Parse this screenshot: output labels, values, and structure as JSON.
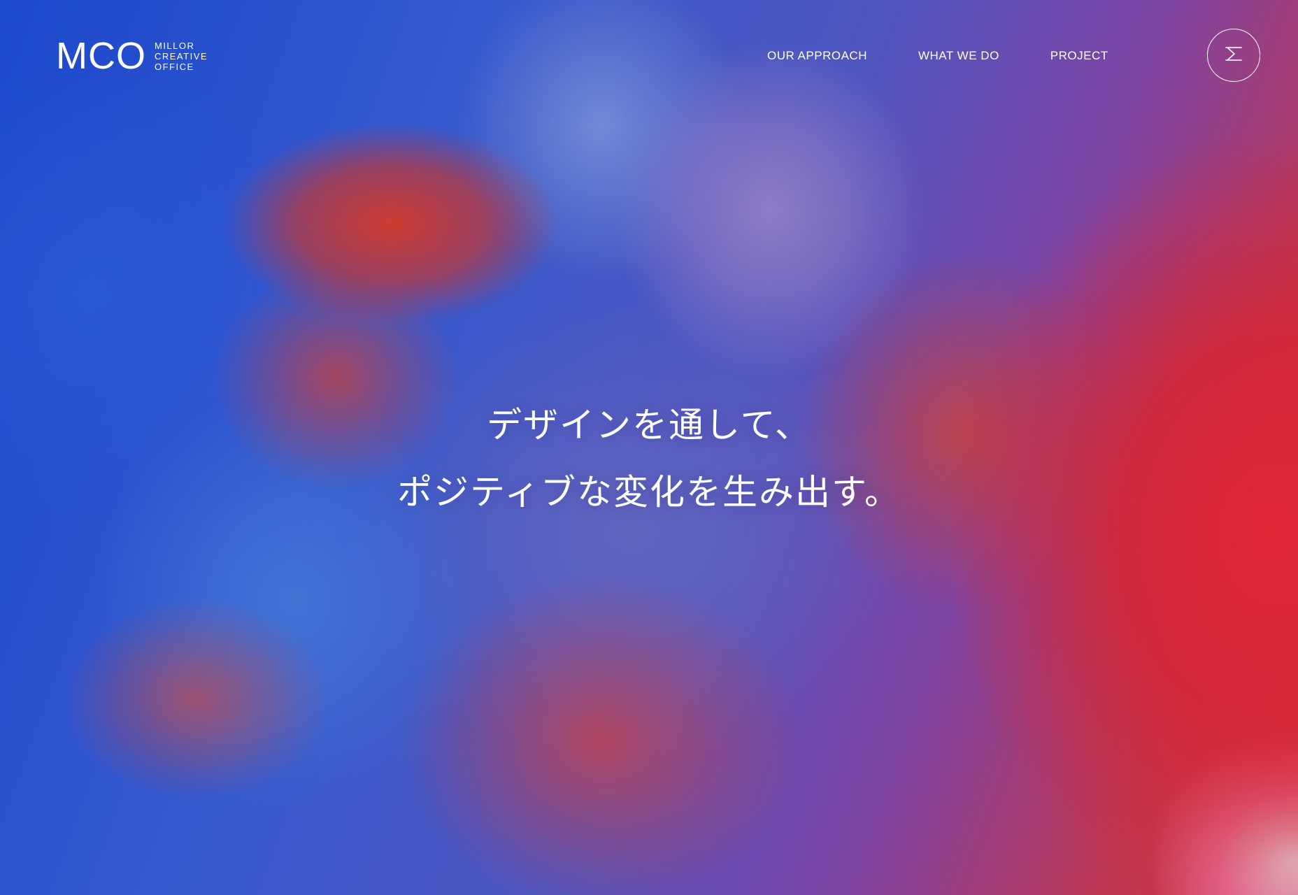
{
  "header": {
    "logo": {
      "mark": "MCO",
      "sub_lines": [
        "MILLOR",
        "CREATIVE",
        "OFFICE"
      ]
    },
    "nav": [
      {
        "label": "OUR APPROACH"
      },
      {
        "label": "WHAT WE DO"
      },
      {
        "label": "PROJECT"
      }
    ],
    "menu_button": {
      "icon": "menu-m-icon"
    }
  },
  "hero": {
    "tagline": [
      "デザインを通して、",
      "ポジティブな変化を生み出す。"
    ],
    "colors": {
      "blue": "#2d5fe6",
      "red": "#f23b3b",
      "text": "#ffffff"
    }
  }
}
